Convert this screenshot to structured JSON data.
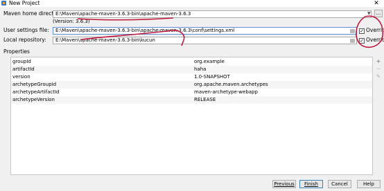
{
  "window": {
    "title": "New Project",
    "close_glyph": "✕"
  },
  "maven_home": {
    "label": "Maven home directory:",
    "value": "E:\\Maven\\apache-maven-3.6.3-bin\\apache-maven-3.6.3",
    "version": "(Version: 3.6.3)",
    "browse": "..."
  },
  "settings_file": {
    "label": "User settings file:",
    "value": "E:\\Maven\\apache-maven-3.6.3-bin\\apache-maven-3.6.3\\conf\\settings.xml",
    "override_label": "Override",
    "override_checked": true
  },
  "local_repo": {
    "label": "Local repository:",
    "value": "E:\\Maven\\apache-maven-3.6.3-bin\\kucun",
    "override_label": "Override",
    "override_checked": true
  },
  "properties": {
    "label": "Properties",
    "rows": [
      {
        "key": "groupId",
        "value": "org.example"
      },
      {
        "key": "artifactId",
        "value": "haha"
      },
      {
        "key": "version",
        "value": "1.0-SNAPSHOT"
      },
      {
        "key": "archetypeGroupId",
        "value": "org.apache.maven.archetypes"
      },
      {
        "key": "archetypeArtifactId",
        "value": "maven-archetype-webapp"
      },
      {
        "key": "archetypeVersion",
        "value": "RELEASE"
      }
    ],
    "tools": [
      "+",
      "−",
      "✎"
    ]
  },
  "footer": {
    "previous": "Previous",
    "finish": "Finish",
    "cancel": "Cancel",
    "help": "Help"
  },
  "colors": {
    "annotation": "#c0183c",
    "accent": "#3c7fb1"
  },
  "icons": {
    "folder": "folder-icon",
    "dropdown": "chevron-down-icon",
    "app": "intellij-icon"
  }
}
